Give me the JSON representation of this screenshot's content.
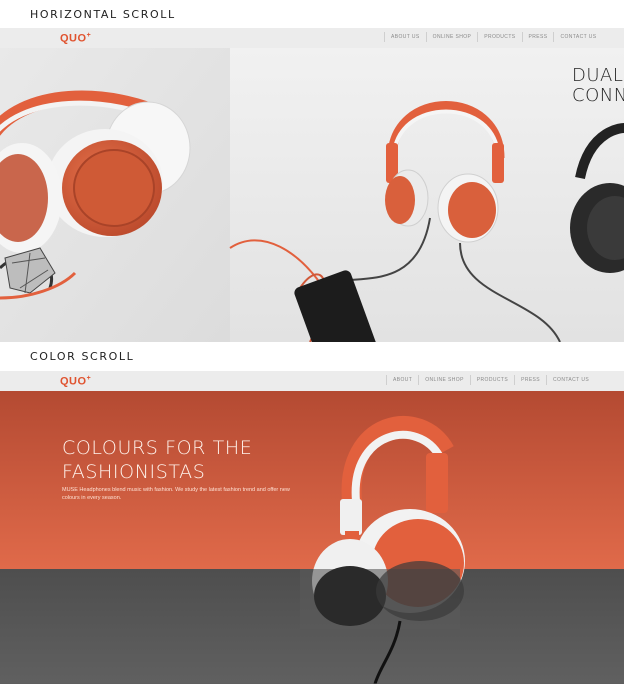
{
  "sections": {
    "horizontal_label": "HORIZONTAL SCROLL",
    "color_label": "COLOR SCROLL"
  },
  "top_site": {
    "logo": "QUO",
    "logo_mark": "+",
    "nav": [
      "ABOUT US",
      "ONLINE SHOP",
      "PRODUCTS",
      "PRESS",
      "CONTACT US"
    ],
    "hero_text_line1": "DUAL",
    "hero_text_line2": "CONN"
  },
  "bottom_site": {
    "logo": "QUO",
    "logo_mark": "+",
    "nav": [
      "ABOUT",
      "ONLINE SHOP",
      "PRODUCTS",
      "PRESS",
      "CONTACT US"
    ],
    "title_line1": "COLOURS FOR THE",
    "title_line2": "FASHIONISTAS",
    "body": "MUSE Headphones blend music with fashion. We study the latest fashion trend and offer new colours in every season."
  },
  "colors": {
    "accent": "#e0532f",
    "orange_band_top": "#b44a32",
    "orange_band_bottom": "#e06a4a",
    "gray_band": "#555555",
    "light_bg": "#e9e9e9"
  }
}
